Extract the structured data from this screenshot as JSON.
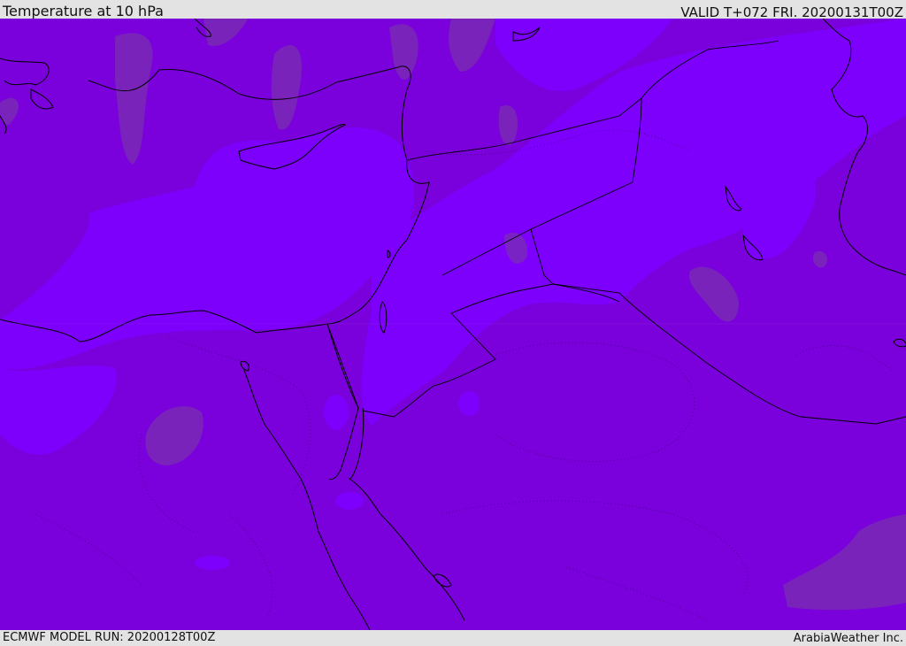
{
  "header": {
    "title": "Temperature at 10 hPa",
    "valid": "VALID T+072 FRI. 20200131T00Z"
  },
  "footer": {
    "model_run": "ECMWF MODEL RUN: 20200128T00Z",
    "credit": "ArabiaWeather Inc."
  },
  "map": {
    "field": "Temperature at 10 hPa",
    "colors": {
      "base": "#7a00dc",
      "light_band": "#7d00fd",
      "warm_patch": "#7a2fb0",
      "coastline": "#000000",
      "contour": "#3a0070"
    }
  }
}
